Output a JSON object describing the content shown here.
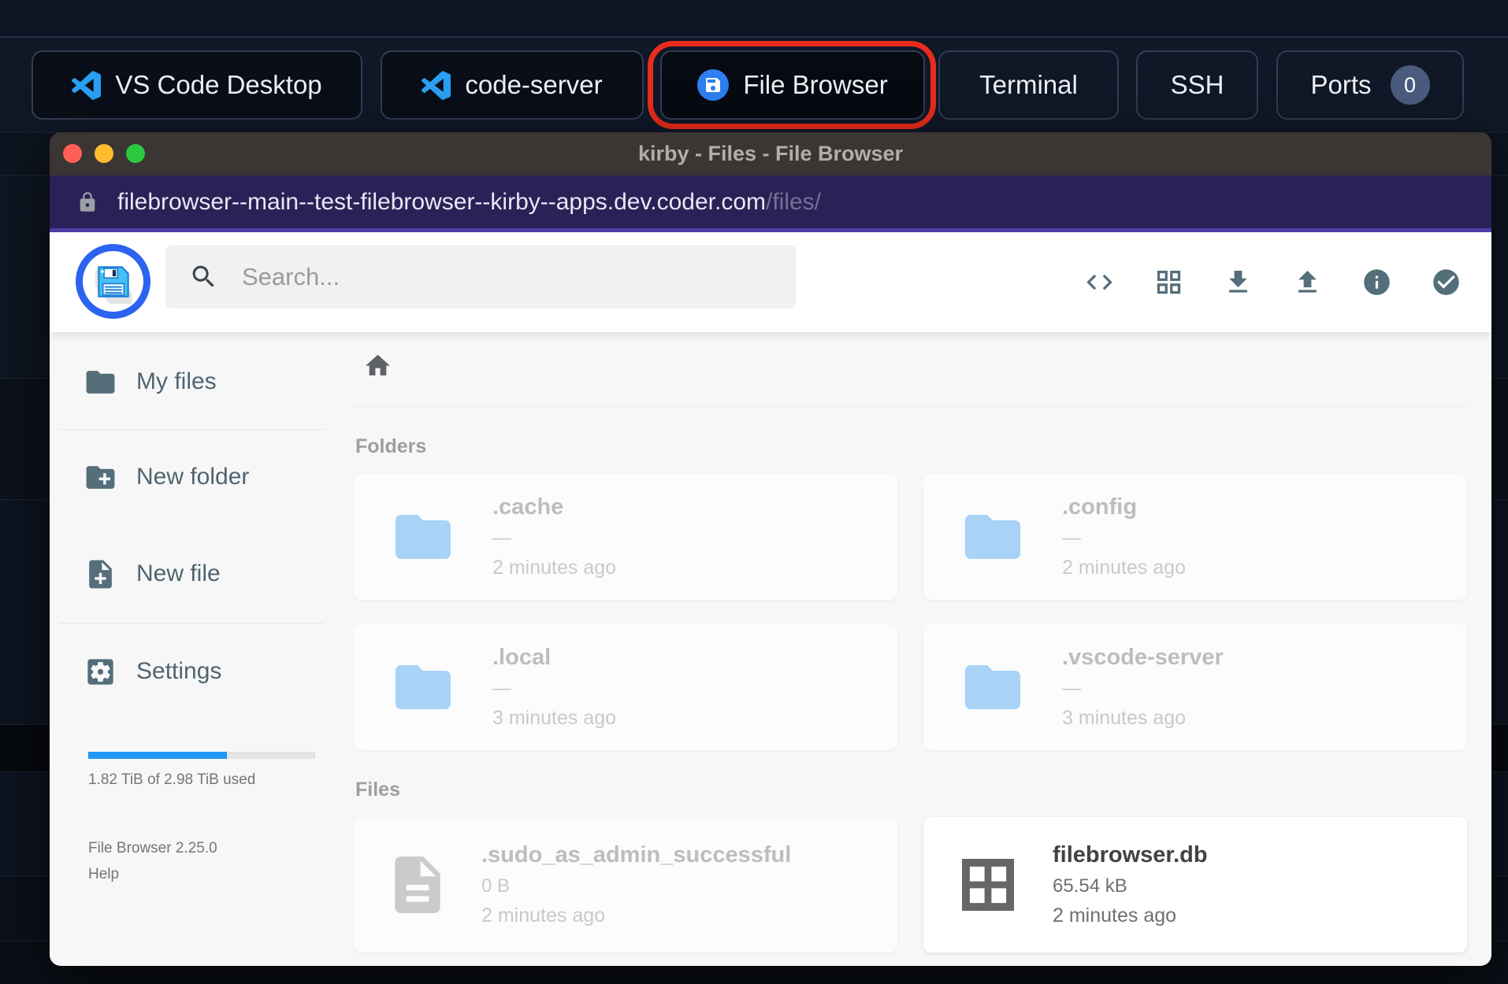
{
  "colors": {
    "accent_blue": "#2196f3",
    "logo_ring_blue": "#2d63f1",
    "annotation_red": "#ea2c1c",
    "urlbar_purple": "#2a2157",
    "purple_divider": "#4c3fa5",
    "titlebar_brown": "#3b3533",
    "icon_slate": "#546e7a"
  },
  "topbar": {
    "buttons": [
      {
        "label": "VS Code Desktop",
        "icon": "vscode-icon"
      },
      {
        "label": "code-server",
        "icon": "vscode-icon"
      },
      {
        "label": "File Browser",
        "icon": "filebrowser-icon",
        "highlighted": true
      },
      {
        "label": "Terminal"
      },
      {
        "label": "SSH"
      },
      {
        "label": "Ports",
        "badge": "0"
      }
    ]
  },
  "window": {
    "title": "kirby - Files - File Browser",
    "url_host": "filebrowser--main--test-filebrowser--kirby--apps.dev.coder.com",
    "url_path": "/files/"
  },
  "header": {
    "search_placeholder": "Search...",
    "toolbar_icons": [
      "code-icon",
      "grid-view-icon",
      "download-icon",
      "upload-icon",
      "info-icon",
      "check-circle-icon"
    ]
  },
  "sidebar": {
    "items": [
      {
        "label": "My files",
        "icon": "folder-icon"
      },
      {
        "label": "New folder",
        "icon": "new-folder-icon"
      },
      {
        "label": "New file",
        "icon": "new-file-icon"
      },
      {
        "label": "Settings",
        "icon": "settings-icon"
      }
    ],
    "usage": {
      "label": "1.82 TiB of 2.98 TiB used",
      "percent": 61,
      "fill_style": "width:61%"
    },
    "version": "File Browser 2.25.0",
    "help_label": "Help"
  },
  "content": {
    "folders": {
      "title": "Folders",
      "items": [
        {
          "name": ".cache",
          "size": "—",
          "modified": "2 minutes ago",
          "hidden": true
        },
        {
          "name": ".config",
          "size": "—",
          "modified": "2 minutes ago",
          "hidden": true
        },
        {
          "name": ".local",
          "size": "—",
          "modified": "3 minutes ago",
          "hidden": true
        },
        {
          "name": ".vscode-server",
          "size": "—",
          "modified": "3 minutes ago",
          "hidden": true
        }
      ]
    },
    "files": {
      "title": "Files",
      "items": [
        {
          "name": ".sudo_as_admin_successful",
          "size": "0 B",
          "modified": "2 minutes ago",
          "hidden": true
        },
        {
          "name": "filebrowser.db",
          "size": "65.54 kB",
          "modified": "2 minutes ago",
          "hidden": false
        }
      ]
    }
  }
}
